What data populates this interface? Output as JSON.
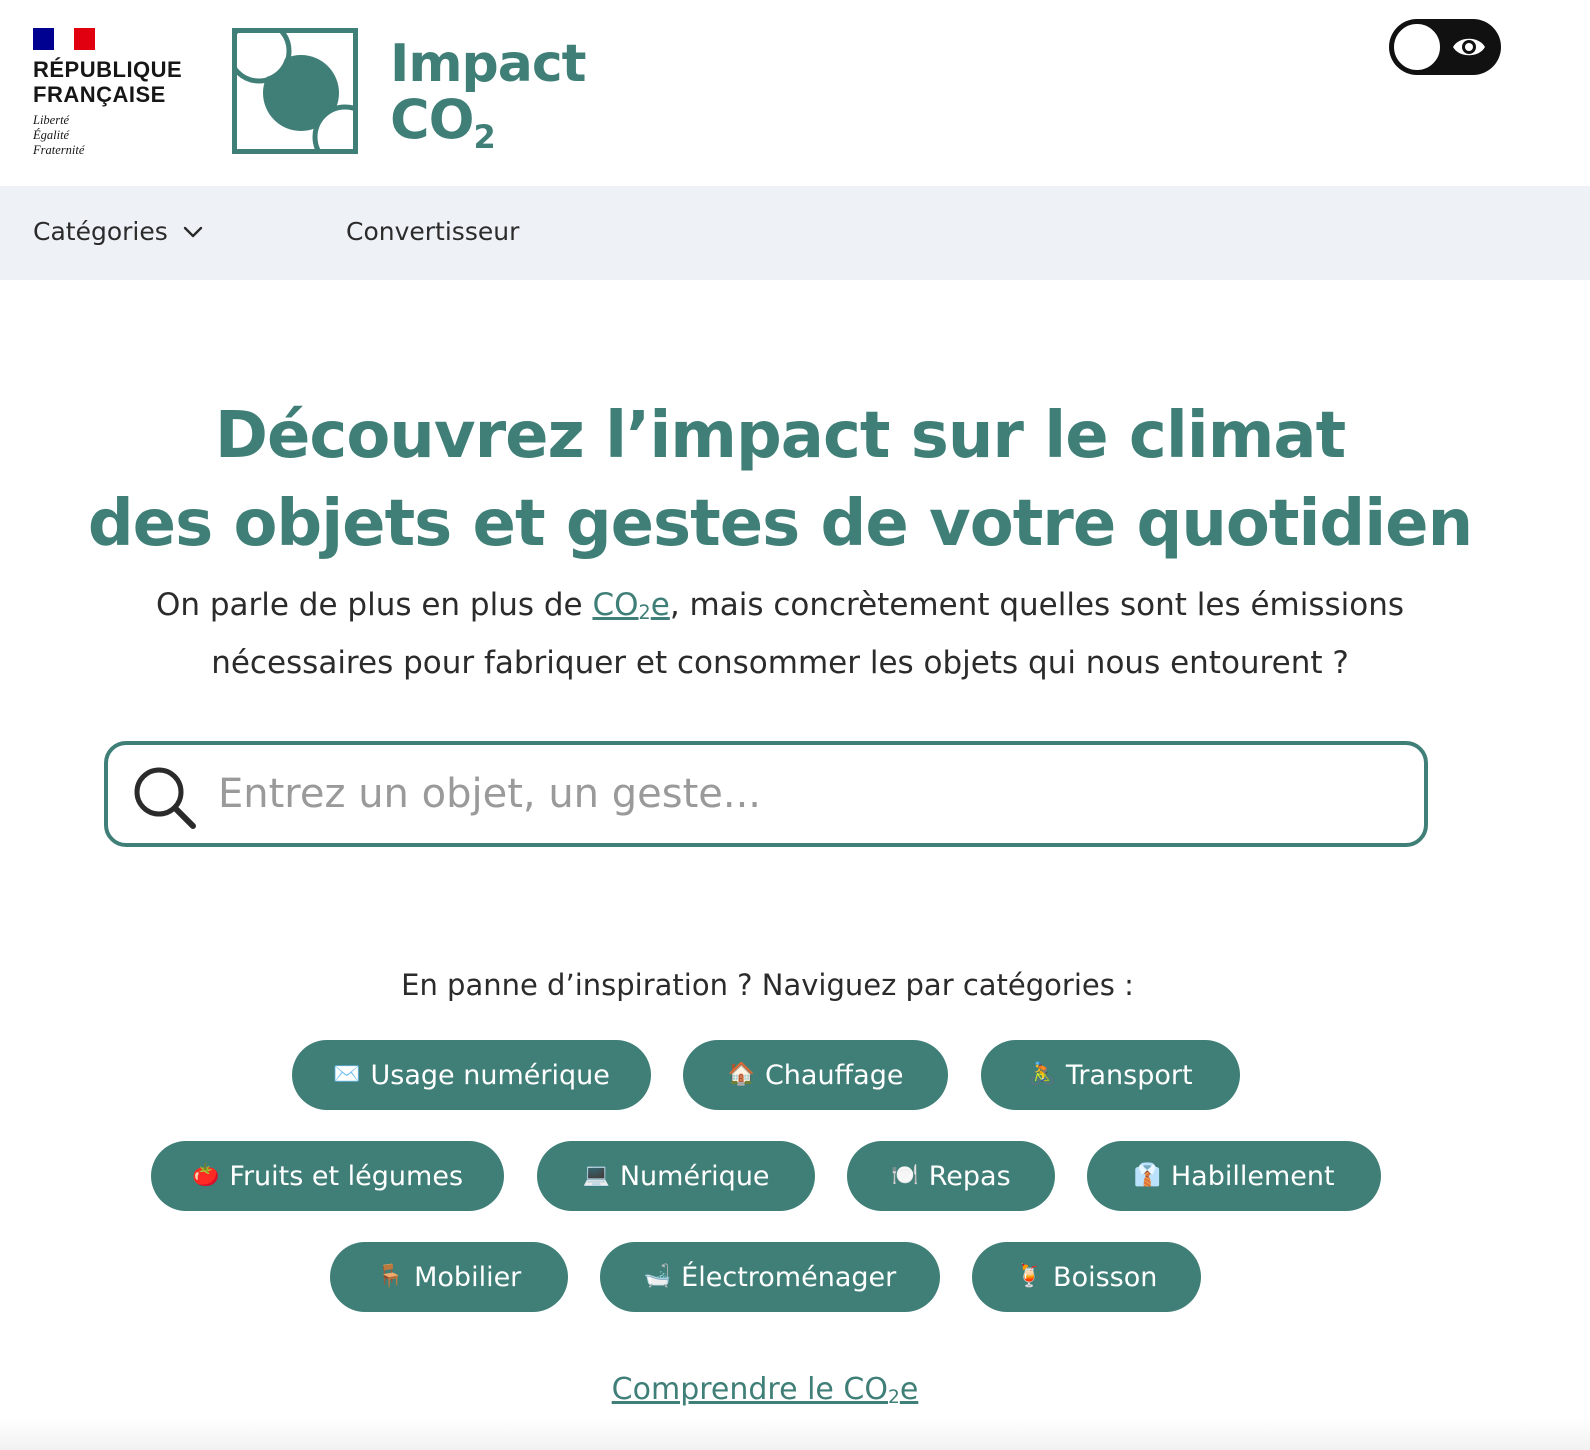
{
  "header": {
    "gov": {
      "line1": "RÉPUBLIQUE",
      "line2": "FRANÇAISE",
      "motto": [
        "Liberté",
        "Égalité",
        "Fraternité"
      ],
      "flag_colors": [
        "#000091",
        "#ffffff",
        "#e1000f"
      ]
    },
    "logo": {
      "name": "Impact",
      "co": "CO",
      "sub": "2",
      "color": "#3f7f77"
    },
    "theme_toggle": {
      "icon": "eye-icon",
      "state": "off"
    }
  },
  "nav": {
    "categories_label": "Catégories",
    "converter_label": "Convertisseur"
  },
  "hero": {
    "title_line1": "Découvrez l’impact sur le climat",
    "title_line2": "des objets et gestes de votre quotidien",
    "sub_before": "On parle de plus en plus de ",
    "sub_link_co": "CO",
    "sub_link_sub": "2",
    "sub_link_e": "e",
    "sub_after_line1": ", mais concrètement quelles sont les émissions",
    "sub_line2": "nécessaires pour fabriquer et consommer les objets qui nous entourent ?"
  },
  "search": {
    "placeholder": "Entrez un objet, un geste...",
    "value": ""
  },
  "categories": {
    "intro": "En panne d’inspiration ? Naviguez par catégories :",
    "items": [
      {
        "emoji": "✉️",
        "label": "Usage numérique"
      },
      {
        "emoji": "🏠",
        "label": "Chauffage"
      },
      {
        "emoji": "🚴",
        "label": "Transport"
      },
      {
        "emoji": "🍅",
        "label": "Fruits et légumes"
      },
      {
        "emoji": "💻",
        "label": "Numérique"
      },
      {
        "emoji": "🍽️",
        "label": "Repas"
      },
      {
        "emoji": "👔",
        "label": "Habillement"
      },
      {
        "emoji": "🪑",
        "label": "Mobilier"
      },
      {
        "emoji": "🛁",
        "label": "Électroménager"
      },
      {
        "emoji": "🍹",
        "label": "Boisson"
      }
    ]
  },
  "learn_more": {
    "text": "Comprendre le CO",
    "sub": "2",
    "e": "e"
  },
  "colors": {
    "accent": "#3f7f77",
    "nav_bg": "#eef2f6"
  }
}
